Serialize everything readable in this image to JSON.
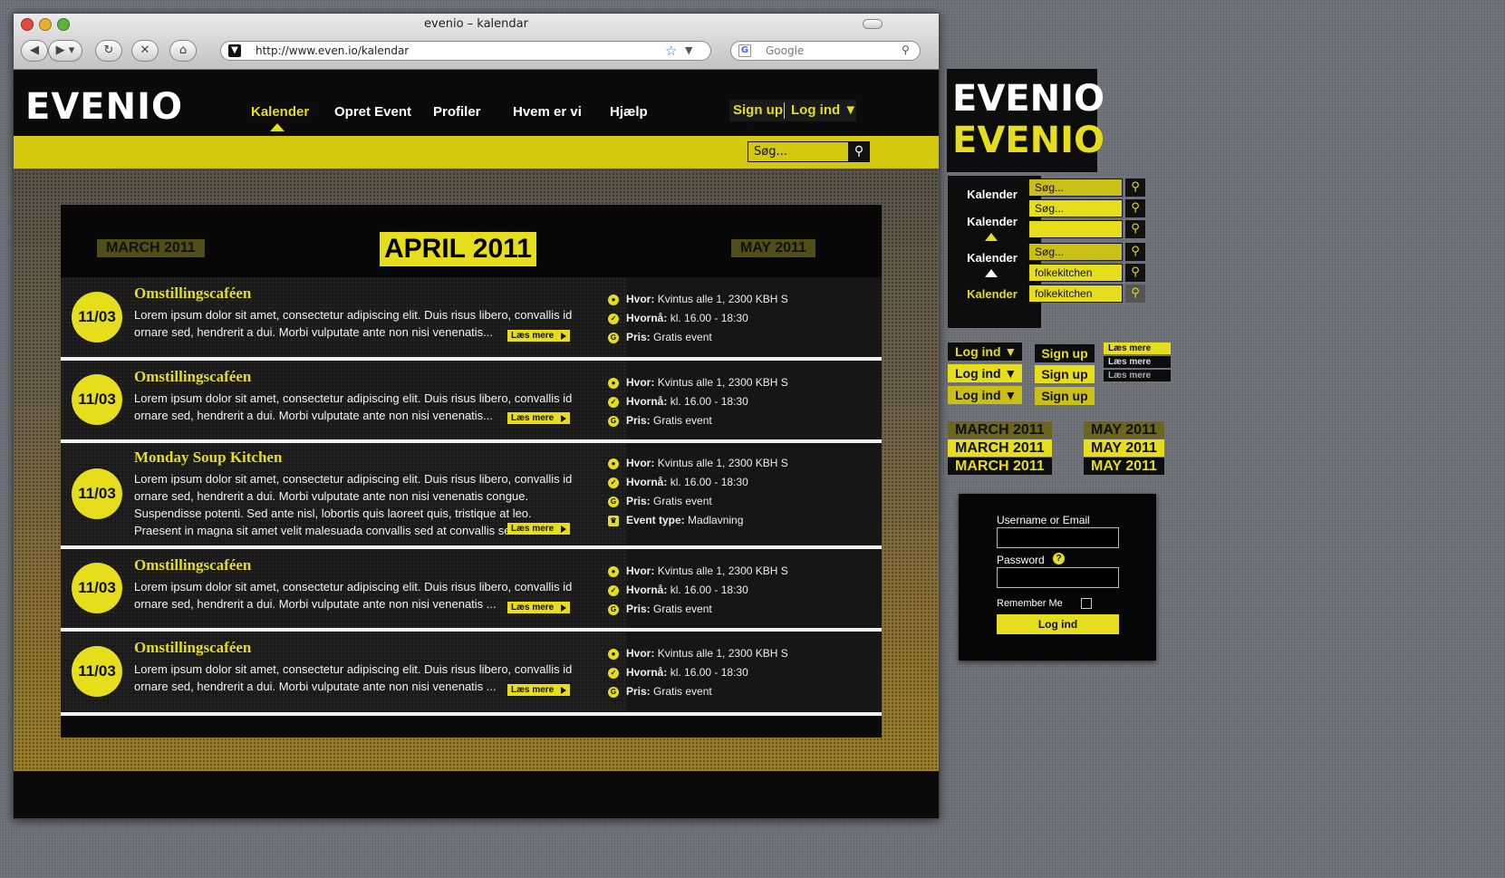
{
  "window": {
    "title": "evenio – kalendar"
  },
  "browser": {
    "url": "http://www.even.io/kalendar",
    "search_placeholder": "Google"
  },
  "site": {
    "logo": "EVENIO",
    "nav": [
      "Kalender",
      "Opret Event",
      "Profiler",
      "Hvem er vi",
      "Hjælp"
    ],
    "auth": {
      "signup": "Sign up",
      "login": "Log ind ▼"
    },
    "search_placeholder": "Søg..."
  },
  "calendar": {
    "current_month": "APRIL 2011",
    "prev_month": "MARCH 2011",
    "next_month": "MAY 2011",
    "read_more": "Læs mere",
    "info_labels": {
      "where": "Hvor:",
      "when": "Hvornå:",
      "price": "Pris:",
      "type": "Event type:"
    },
    "events": [
      {
        "date": "11/03",
        "title": "Omstillingscaféen",
        "desc": "Lorem ipsum dolor sit amet, consectetur adipiscing elit. Duis risus libero, convallis id ornare sed, hendrerit a dui. Morbi vulputate ante non nisi venenatis...",
        "where": "Kvintus alle 1, 2300 KBH S",
        "when": "kl. 16.00 - 18:30",
        "price": "Gratis event"
      },
      {
        "date": "11/03",
        "title": "Omstillingscaféen",
        "desc": "Lorem ipsum dolor sit amet, consectetur adipiscing elit. Duis risus libero, convallis id ornare sed, hendrerit a dui. Morbi vulputate ante non nisi venenatis...",
        "where": "Kvintus alle 1, 2300 KBH S",
        "when": "kl. 16.00 - 18:30",
        "price": "Gratis event"
      },
      {
        "date": "11/03",
        "title": "Monday Soup Kitchen",
        "desc": "Lorem ipsum dolor sit amet, consectetur adipiscing elit. Duis risus libero, convallis id ornare sed, hendrerit a dui. Morbi vulputate ante non nisi venenatis congue. Suspendisse potenti. Sed ante nisl, lobortis quis laoreet quis, tristique at leo. Praesent in magna sit amet velit malesuada convallis sed at convallis sed odio..",
        "where": "Kvintus alle 1, 2300 KBH S",
        "when": "kl. 16.00 - 18:30",
        "price": "Gratis event",
        "type": "Madlavning"
      },
      {
        "date": "11/03",
        "title": "Omstillingscaféen",
        "desc": "Lorem ipsum dolor sit amet, consectetur adipiscing elit. Duis risus libero, convallis id ornare sed, hendrerit a dui. Morbi vulputate ante non nisi venenatis ...",
        "where": "Kvintus alle 1, 2300 KBH S",
        "when": "kl. 16.00 - 18:30",
        "price": "Gratis event"
      },
      {
        "date": "11/03",
        "title": "Omstillingscaféen",
        "desc": "Lorem ipsum dolor sit amet, consectetur adipiscing elit. Duis risus libero, convallis id ornare sed, hendrerit a dui. Morbi vulputate ante non nisi venenatis ...",
        "where": "Kvintus alle 1, 2300 KBH S",
        "when": "kl. 16.00 - 18:30",
        "price": "Gratis event"
      }
    ]
  },
  "styleguide": {
    "logo": "EVENIO",
    "nav_label": "Kalender",
    "search_values": [
      "Søg...",
      "Søg...",
      "",
      "Søg...",
      "folkekitchen",
      "folkekitchen"
    ],
    "login_label": "Log ind ▼",
    "signup_label": "Sign up",
    "read_more": "Læs mere",
    "prev_month": "MARCH 2011",
    "next_month": "MAY 2011"
  },
  "login_form": {
    "username_label": "Username or Email",
    "password_label": "Password",
    "remember_label": "Remember Me",
    "button": "Log ind"
  },
  "colors": {
    "accent": "#e6dd1c",
    "dark": "#0b0b0b",
    "header_bar": "#d4c90e"
  }
}
